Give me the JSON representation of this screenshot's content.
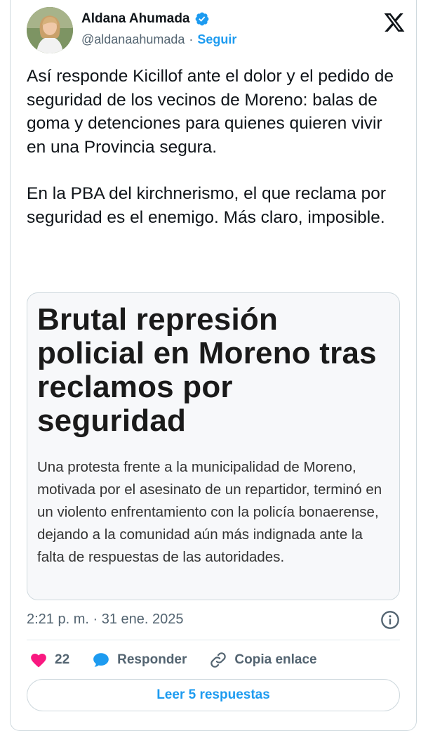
{
  "author": {
    "name": "Aldana Ahumada",
    "handle": "@aldanaahumada",
    "separator": "·",
    "follow_label": "Seguir"
  },
  "tweet": {
    "paragraphs": [
      "Así responde Kicillof ante el dolor y el pedido de seguridad de los vecinos de Moreno: balas de goma y detenciones para quienes quieren vivir en una Provincia segura.",
      "En la PBA del kirchnerismo, el que reclama por seguridad es el enemigo. Más claro, imposible."
    ]
  },
  "quote": {
    "title": "Brutal represión policial en Moreno tras reclamos por seguridad",
    "body": "Una protesta frente a la municipalidad de Moreno, motivada por el asesinato de un repartidor, terminó en un violento enfrentamiento con la policía bonaerense, dejando a la comunidad aún más indignada ante la falta de respuestas de las autoridades."
  },
  "meta": {
    "timestamp": "2:21 p. m. · 31 ene. 2025"
  },
  "actions": {
    "like_count": "22",
    "reply_label": "Responder",
    "copy_label": "Copia enlace"
  },
  "read_replies_label": "Leer 5 respuestas",
  "colors": {
    "accent": "#1d9bf0",
    "like": "#f91880",
    "text": "#0f1419",
    "muted": "#536471"
  },
  "icons": {
    "verified": "verified-badge-icon",
    "logo": "x-logo-icon",
    "info": "info-icon",
    "like": "heart-icon",
    "reply": "speech-bubble-icon",
    "copy": "link-icon"
  }
}
